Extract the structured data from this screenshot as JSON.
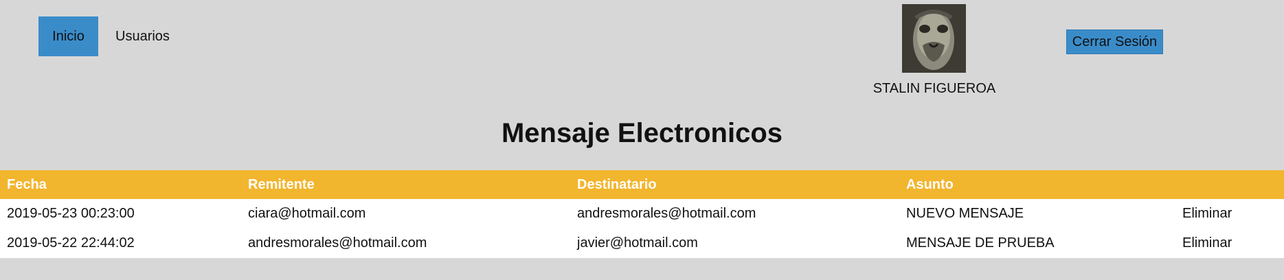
{
  "nav": {
    "items": [
      {
        "label": "Inicio",
        "active": true
      },
      {
        "label": "Usuarios",
        "active": false
      }
    ]
  },
  "user": {
    "name": "STALIN FIGUEROA",
    "avatar_icon": "user-avatar-photo"
  },
  "logout": {
    "label": "Cerrar Sesión"
  },
  "page": {
    "title": "Mensaje Electronicos"
  },
  "table": {
    "headers": [
      "Fecha",
      "Remitente",
      "Destinatario",
      "Asunto",
      ""
    ],
    "rows": [
      {
        "fecha": "2019-05-23 00:23:00",
        "remitente": "ciara@hotmail.com",
        "destinatario": "andresmorales@hotmail.com",
        "asunto": "NUEVO MENSAJE",
        "action": "Eliminar"
      },
      {
        "fecha": "2019-05-22 22:44:02",
        "remitente": "andresmorales@hotmail.com",
        "destinatario": "javier@hotmail.com",
        "asunto": "MENSAJE DE PRUEBA",
        "action": "Eliminar"
      }
    ]
  },
  "colors": {
    "background": "#d7d7d7",
    "accent_blue": "#3a8cc9",
    "header_yellow": "#f2b52e",
    "table_body": "#ffffff"
  }
}
